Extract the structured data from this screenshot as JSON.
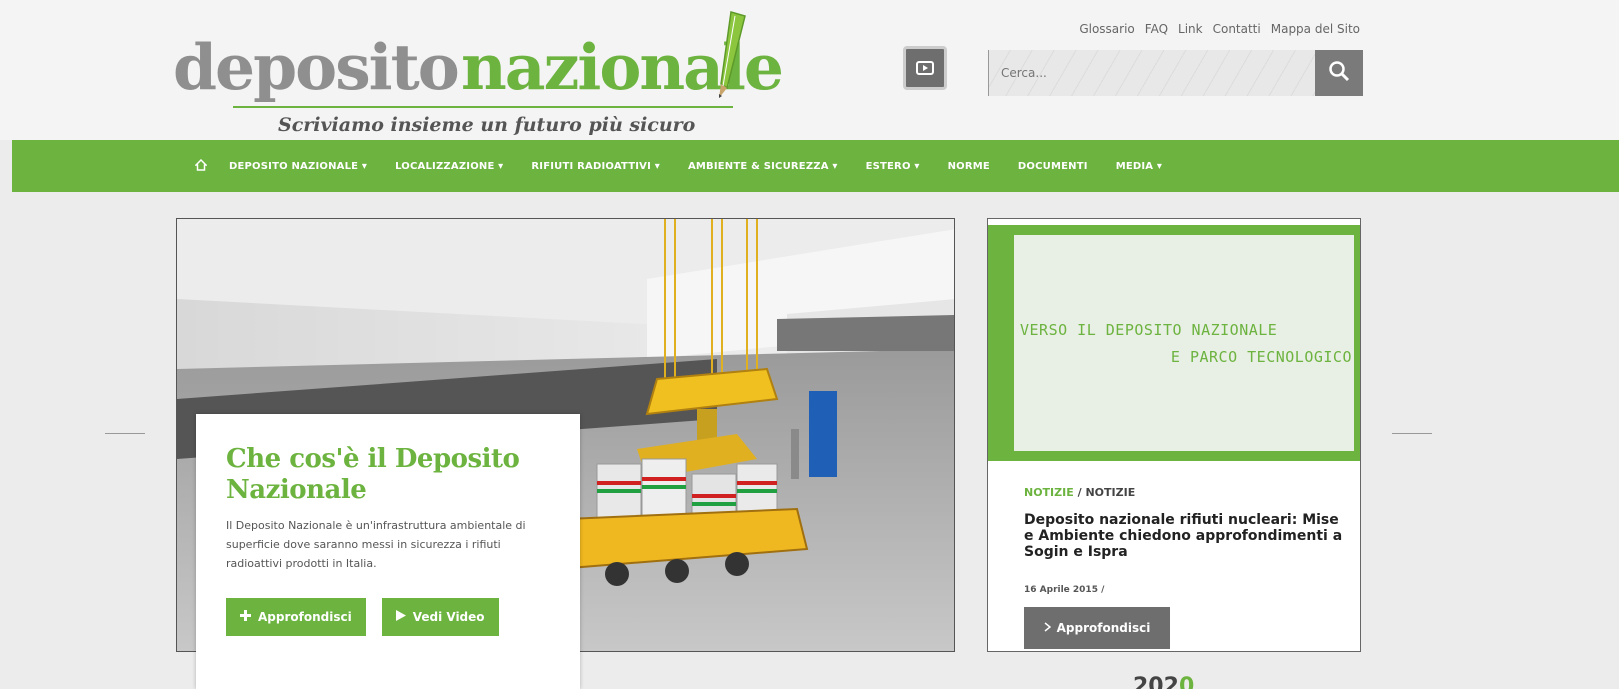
{
  "header": {
    "logo_part1": "deposito",
    "logo_part2": "nazionale",
    "tagline": "Scriviamo insieme un futuro più sicuro",
    "util_links": [
      "Glossario",
      "FAQ",
      "Link",
      "Contatti",
      "Mappa del Sito"
    ],
    "search_placeholder": "Cerca..."
  },
  "nav": {
    "items": [
      "DEPOSITO NAZIONALE ▾",
      "LOCALIZZAZIONE ▾",
      "RIFIUTI RADIOATTIVI ▾",
      "AMBIENTE & SICUREZZA ▾",
      "ESTERO ▾",
      "NORME",
      "DOCUMENTI",
      "MEDIA ▾"
    ]
  },
  "slide": {
    "title": "Che cos'è il Deposito Nazionale",
    "text": "Il Deposito Nazionale è un'infrastruttura ambientale di superficie dove saranno messi in sicurezza i rifiuti radioattivi prodotti in Italia.",
    "btn_more": "Approfondisci",
    "btn_video": "Vedi Video"
  },
  "news": {
    "banner_line1": "VERSO IL DEPOSITO NAZIONALE",
    "banner_line2": "E PARCO TECNOLOGICO",
    "category": "NOTIZIE",
    "separator": "/",
    "subcategory": "NOTIZIE",
    "title": "Deposito nazionale rifiuti nucleari: Mise e Ambiente chiedono approfondimenti a Sogin e Ispra",
    "date": "16 Aprile 2015 /",
    "btn": "Approfondisci",
    "peek_text": "202",
    "peek_accent": "0"
  },
  "colors": {
    "brand_green": "#6cb33f",
    "dark_gray": "#6e6e6e"
  },
  "icons": [
    "pencil-icon",
    "youtube-icon",
    "search-icon",
    "home-icon",
    "plus-icon",
    "play-icon",
    "chevron-right-icon"
  ]
}
